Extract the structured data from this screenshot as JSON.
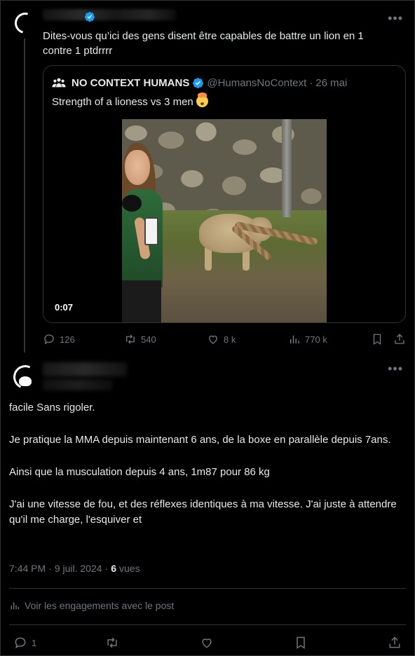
{
  "parent_tweet": {
    "text": "Dites-vous qu’ici des gens disent être capables de battre un lion en 1 contre 1 ptdrrrr",
    "quoted": {
      "name": "NO CONTEXT HUMANS",
      "handle": "@HumansNoContext",
      "separator": "·",
      "date": "26 mai",
      "text": "Strength of a lioness vs 3 men",
      "video_time": "0:07"
    },
    "actions": {
      "replies": "126",
      "reposts": "540",
      "likes": "8 k",
      "views": "770 k"
    }
  },
  "main_tweet": {
    "paragraphs": [
      "facile Sans rigoler.",
      "Je pratique la MMA depuis maintenant 6 ans, de la boxe en parallèle depuis 7ans.",
      "Ainsi que la musculation depuis 4 ans, 1m87 pour 86 kg",
      "J'ai une vitesse de fou, et des réflexes identiques à ma vitesse. J'ai juste à attendre qu'il me charge, l'esquiver et"
    ],
    "time": "7:44 PM",
    "separator": "·",
    "date": "9 juil. 2024",
    "date_sep": "·",
    "views_count": "6",
    "views_label": "vues",
    "engagements_label": "Voir les engagements avec le post",
    "actions": {
      "replies": "1"
    }
  },
  "colors": {
    "background": "#000000",
    "text": "#e7e9ea",
    "muted": "#71767b",
    "border": "#2f3336",
    "verified": "#1d9bf0"
  },
  "icons": [
    "reply-icon",
    "repost-icon",
    "like-icon",
    "views-icon",
    "bookmark-icon",
    "share-icon",
    "more-icon",
    "verified-icon",
    "analytics-icon"
  ]
}
